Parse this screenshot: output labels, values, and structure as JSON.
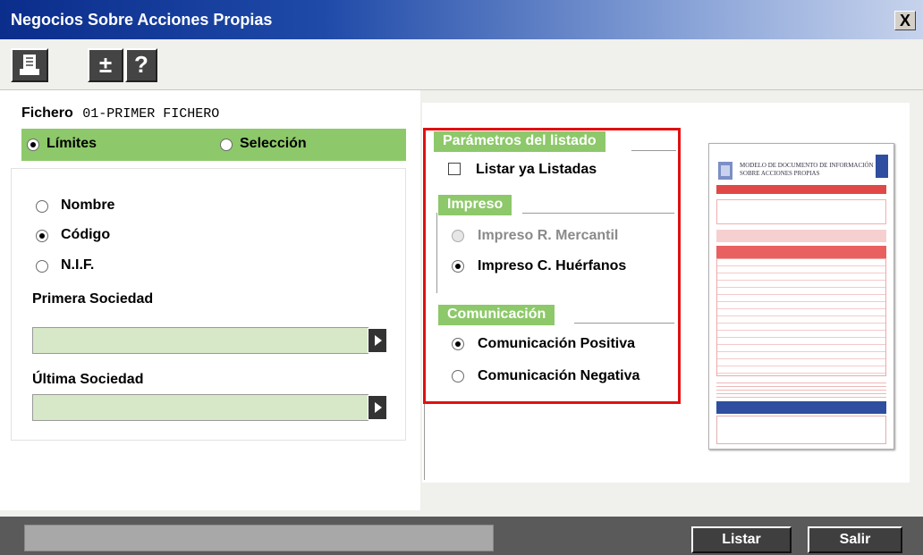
{
  "window": {
    "title": "Negocios Sobre Acciones Propias",
    "close_label": "X"
  },
  "toolbar": {
    "plus_label": "±",
    "help_label": "?"
  },
  "file": {
    "label": "Fichero",
    "value": "01-PRIMER FICHERO"
  },
  "mode": {
    "limits_label": "Límites",
    "selection_label": "Selección",
    "selected": "limits"
  },
  "order": {
    "name_label": "Nombre",
    "code_label": "Código",
    "nif_label": "N.I.F.",
    "selected": "code"
  },
  "first_company": {
    "label": "Primera Sociedad",
    "value": ""
  },
  "last_company": {
    "label": "Última Sociedad",
    "value": ""
  },
  "params": {
    "title": "Parámetros del listado",
    "list_already_label": "Listar ya Listadas",
    "list_already_checked": false,
    "print_group": {
      "title": "Impreso",
      "mercantil_label": "Impreso R. Mercantil",
      "huerfanos_label": "Impreso C. Huérfanos",
      "selected": "huerfanos"
    },
    "comm_group": {
      "title": "Comunicación",
      "positive_label": "Comunicación Positiva",
      "negative_label": "Comunicación Negativa",
      "selected": "positive"
    }
  },
  "preview": {
    "heading_line1": "MODELO DE DOCUMENTO DE INFORMACIÓN",
    "heading_line2": "SOBRE ACCIONES PROPIAS"
  },
  "footer": {
    "list_button": "Listar",
    "exit_button": "Salir",
    "status": ""
  },
  "colors": {
    "accent_green": "#8dc86a",
    "highlight_red": "#e01010",
    "title_blue": "#0b2d8c"
  }
}
